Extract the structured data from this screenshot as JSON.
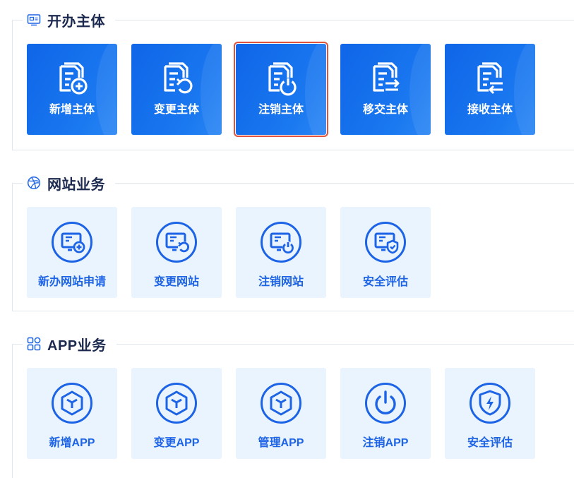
{
  "sections": {
    "entity": {
      "title": "开办主体",
      "icon": "id-card-icon",
      "cards": [
        {
          "label": "新增主体",
          "icon": "document-add-icon"
        },
        {
          "label": "变更主体",
          "icon": "document-change-icon"
        },
        {
          "label": "注销主体",
          "icon": "document-cancel-icon",
          "selected": true
        },
        {
          "label": "移交主体",
          "icon": "document-transfer-icon"
        },
        {
          "label": "接收主体",
          "icon": "document-receive-icon"
        }
      ]
    },
    "website": {
      "title": "网站业务",
      "icon": "globe-icon",
      "cards": [
        {
          "label": "新办网站申请",
          "icon": "monitor-add-icon"
        },
        {
          "label": "变更网站",
          "icon": "monitor-change-icon"
        },
        {
          "label": "注销网站",
          "icon": "monitor-cancel-icon"
        },
        {
          "label": "安全评估",
          "icon": "monitor-shield-icon"
        }
      ]
    },
    "app": {
      "title": "APP业务",
      "icon": "grid-icon",
      "cards": [
        {
          "label": "新增APP",
          "icon": "cube-icon"
        },
        {
          "label": "变更APP",
          "icon": "cube-icon"
        },
        {
          "label": "管理APP",
          "icon": "cube-icon"
        },
        {
          "label": "注销APP",
          "icon": "power-icon"
        },
        {
          "label": "安全评估",
          "icon": "shield-bolt-icon"
        }
      ]
    }
  },
  "colors": {
    "primary": "#1773ee",
    "light_card": "#e9f4fe",
    "icon_blue": "#1d63e6",
    "title": "#1d2a50",
    "selection": "#e0533c"
  }
}
